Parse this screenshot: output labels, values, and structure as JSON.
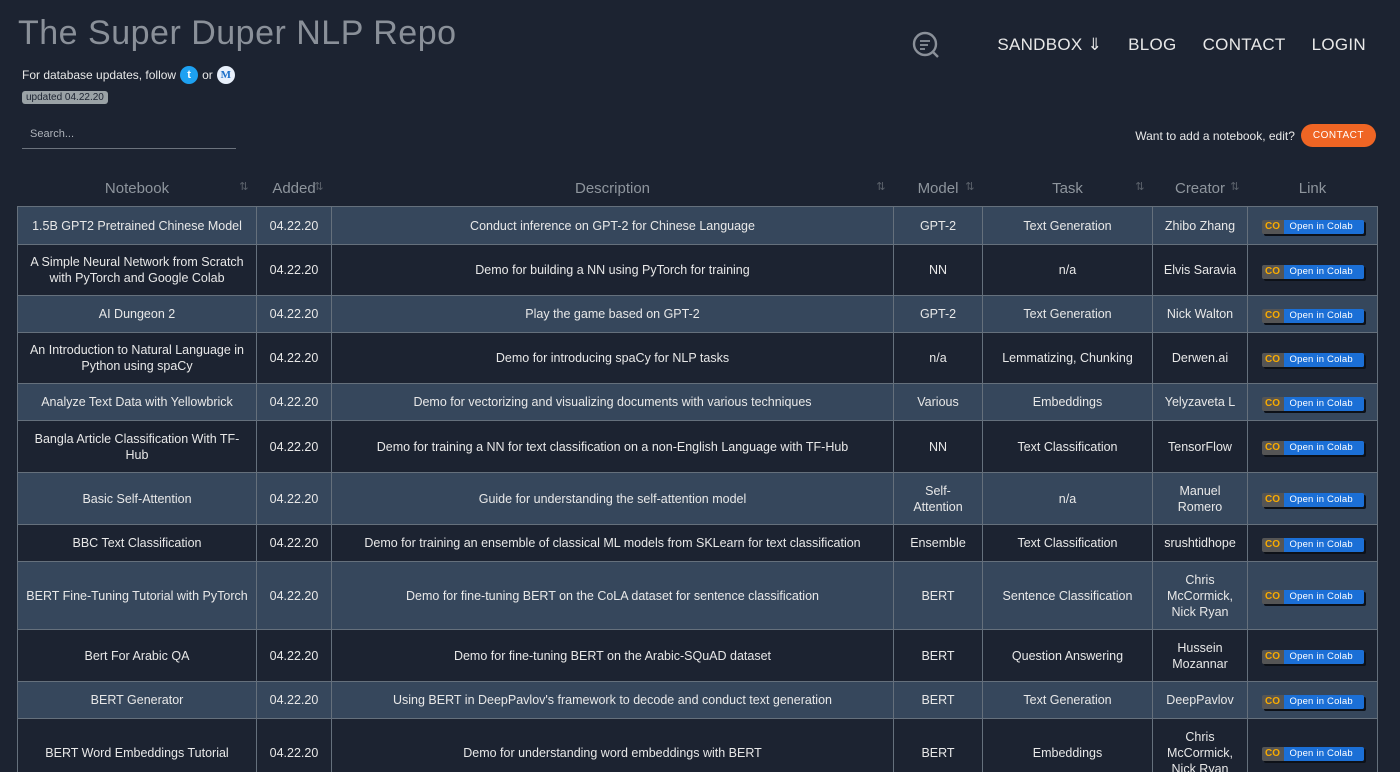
{
  "site": {
    "title": "The Super Duper NLP Repo",
    "follow_text": "For database updates, follow",
    "or_text": "or",
    "twitter_glyph": "t",
    "medium_glyph": "M",
    "updated": "updated 04.22.20"
  },
  "nav": {
    "items": [
      "SANDBOX ⇓",
      "BLOG",
      "CONTACT",
      "LOGIN"
    ]
  },
  "search": {
    "placeholder": "Search..."
  },
  "add_notebook": {
    "text": "Want to add a notebook, edit?",
    "button": "CONTACT"
  },
  "colors": {
    "accent": "#ef6524",
    "row_odd": "#36475c",
    "row_even": "#1c2331",
    "colab_blue": "#1b6fd6"
  },
  "table": {
    "columns": [
      "Notebook",
      "Added",
      "Description",
      "Model",
      "Task",
      "Creator",
      "Link"
    ],
    "link_badge": {
      "logo": "CO",
      "label": "Open in Colab"
    },
    "rows": [
      [
        "1.5B GPT2 Pretrained Chinese Model",
        "04.22.20",
        "Conduct inference on GPT-2 for Chinese Language",
        "GPT-2",
        "Text Generation",
        "Zhibo Zhang"
      ],
      [
        "A Simple Neural Network from Scratch with PyTorch and Google Colab",
        "04.22.20",
        "Demo for building a NN using PyTorch for training",
        "NN",
        "n/a",
        "Elvis Saravia"
      ],
      [
        "AI Dungeon 2",
        "04.22.20",
        "Play the game based on GPT-2",
        "GPT-2",
        "Text Generation",
        "Nick Walton"
      ],
      [
        "An Introduction to Natural Language in Python using spaCy",
        "04.22.20",
        "Demo for introducing spaCy for NLP tasks",
        "n/a",
        "Lemmatizing, Chunking",
        "Derwen.ai"
      ],
      [
        "Analyze Text Data with Yellowbrick",
        "04.22.20",
        "Demo for vectorizing and visualizing documents with various techniques",
        "Various",
        "Embeddings",
        "Yelyzaveta L"
      ],
      [
        "Bangla Article Classification With TF-Hub",
        "04.22.20",
        "Demo for training a NN for text classification on a non-English Language with TF-Hub",
        "NN",
        "Text Classification",
        "TensorFlow"
      ],
      [
        "Basic Self-Attention",
        "04.22.20",
        "Guide for understanding the self-attention model",
        "Self-Attention",
        "n/a",
        "Manuel Romero"
      ],
      [
        "BBC Text Classification",
        "04.22.20",
        "Demo for training an ensemble of classical ML models from SKLearn for text classification",
        "Ensemble",
        "Text Classification",
        "srushtidhope"
      ],
      [
        "BERT Fine-Tuning Tutorial with PyTorch",
        "04.22.20",
        "Demo for fine-tuning BERT on the CoLA dataset for sentence classification",
        "BERT",
        "Sentence Classification",
        "Chris McCormick, Nick Ryan"
      ],
      [
        "Bert For Arabic QA",
        "04.22.20",
        "Demo for fine-tuning BERT on the Arabic-SQuAD dataset",
        "BERT",
        "Question Answering",
        "Hussein Mozannar"
      ],
      [
        "BERT Generator",
        "04.22.20",
        "Using BERT in DeepPavlov's framework to decode and conduct text generation",
        "BERT",
        "Text Generation",
        "DeepPavlov"
      ],
      [
        "BERT Word Embeddings Tutorial",
        "04.22.20",
        "Demo for understanding word embeddings with BERT",
        "BERT",
        "Embeddings",
        "Chris McCormick, Nick Ryan"
      ]
    ]
  }
}
